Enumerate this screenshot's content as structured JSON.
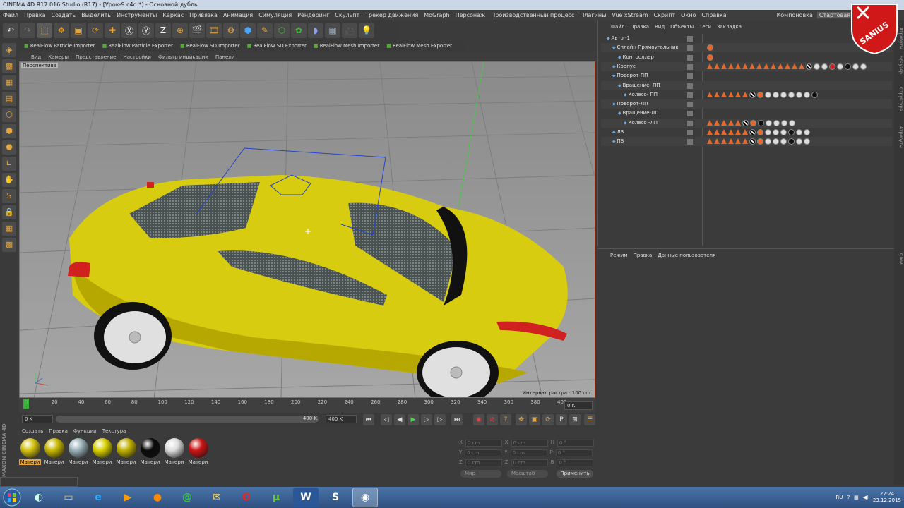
{
  "window": {
    "title": "CINEMA 4D R17.016 Studio (R17) - [Урок-9.c4d *] - Основной дубль"
  },
  "menu": [
    "Файл",
    "Правка",
    "Создать",
    "Выделить",
    "Инструменты",
    "Каркас",
    "Привязка",
    "Анимация",
    "Симуляция",
    "Рендеринг",
    "Скульпт",
    "Трекер движения",
    "MoGraph",
    "Персонаж",
    "Производственный процесс",
    "Плагины",
    "Vue xStream",
    "Скрипт",
    "Окно",
    "Справка"
  ],
  "layout": {
    "label": "Компоновка",
    "active": "Стартовая (п"
  },
  "plugins": [
    "RealFlow Particle Importer",
    "RealFlow Particle Exporter",
    "RealFlow SD Importer",
    "RealFlow SD Exporter",
    "RealFlow Mesh Importer",
    "RealFlow Mesh Exporter"
  ],
  "viewport": {
    "menu": [
      "Вид",
      "Камеры",
      "Представление",
      "Настройки",
      "Фильтр индикации",
      "Панели"
    ],
    "label": "Перспектива",
    "status": "Интервал растра : 100 cm"
  },
  "timeline": {
    "ticks": [
      "0",
      "20",
      "40",
      "60",
      "80",
      "100",
      "120",
      "140",
      "160",
      "180",
      "200",
      "220",
      "240",
      "260",
      "280",
      "300",
      "320",
      "340",
      "360",
      "380",
      "400"
    ],
    "current_frame": "0 K",
    "start": "0 K",
    "end": "400 K",
    "end2": "400 K"
  },
  "materials": {
    "menu": [
      "Создать",
      "Правка",
      "Функции",
      "Текстура"
    ],
    "items": [
      {
        "label": "Матери",
        "color": "#d4c210"
      },
      {
        "label": "Матери",
        "color": "#c8b800"
      },
      {
        "label": "Матери",
        "color": "#9ab0b8"
      },
      {
        "label": "Матери",
        "color": "#d8d000"
      },
      {
        "label": "Матери",
        "color": "#c0b000"
      },
      {
        "label": "Матери",
        "color": "#0a0a0a"
      },
      {
        "label": "Матери",
        "color": "#dcdcdc"
      },
      {
        "label": "Матери",
        "color": "#cc1515"
      }
    ]
  },
  "coords": {
    "rows": [
      [
        "X",
        "0 cm",
        "X",
        "0 cm",
        "H",
        "0 °"
      ],
      [
        "Y",
        "0 cm",
        "Y",
        "0 cm",
        "P",
        "0 °"
      ],
      [
        "Z",
        "0 cm",
        "Z",
        "0 cm",
        "B",
        "0 °"
      ]
    ],
    "mode1": "Мир",
    "mode2": "Масштаб",
    "apply": "Применить"
  },
  "objects": {
    "menu": [
      "Файл",
      "Правка",
      "Вид",
      "Объекты",
      "Теги",
      "Закладка"
    ],
    "items": [
      {
        "name": "Авто -1",
        "indent": 0
      },
      {
        "name": "Сплайн Прямоугольник",
        "indent": 1
      },
      {
        "name": "Контроллер",
        "indent": 2
      },
      {
        "name": "Корпус",
        "indent": 1
      },
      {
        "name": "Поворот-ПП",
        "indent": 1
      },
      {
        "name": "Вращение- ПП",
        "indent": 2
      },
      {
        "name": "Колесо- ПП",
        "indent": 3
      },
      {
        "name": "Поворот-ЛП",
        "indent": 1
      },
      {
        "name": "Вращение-ЛП",
        "indent": 2
      },
      {
        "name": "Колесо -ЛП",
        "indent": 3
      },
      {
        "name": "ЛЗ",
        "indent": 1
      },
      {
        "name": "ПЗ",
        "indent": 1
      }
    ]
  },
  "attributes": {
    "menu": [
      "Режим",
      "Правка",
      "Данные пользователя"
    ]
  },
  "righttabs": [
    "Атрибуты",
    "Браузер",
    "Структура",
    "Атрибуты",
    "Слои"
  ],
  "brand": "MAXON CINEMA 4D",
  "tray": {
    "lang": "RU",
    "time": "22:24",
    "date": "23.12.2015"
  },
  "logo_text": "SANIUS"
}
